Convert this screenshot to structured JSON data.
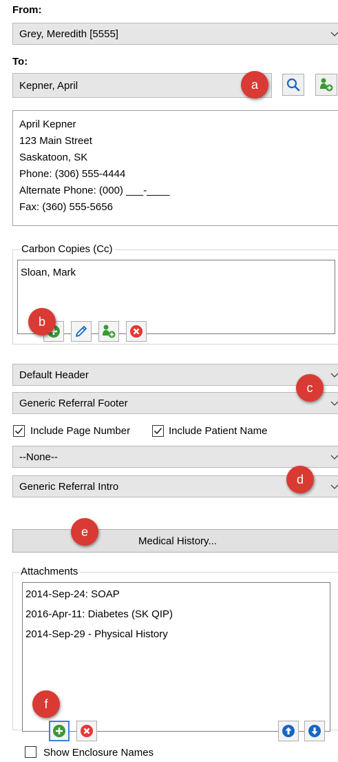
{
  "from": {
    "label": "From:",
    "value": "Grey, Meredith [5555]"
  },
  "to": {
    "label": "To:",
    "value": "Kepner, April"
  },
  "address": {
    "lines": [
      "April Kepner",
      "123 Main Street",
      "Saskatoon, SK",
      "Phone: (306) 555-4444",
      "Alternate Phone: (000) ___-____",
      "Fax: (360) 555-5656"
    ]
  },
  "cc": {
    "title": "Carbon Copies (Cc)",
    "items": [
      "Sloan, Mark"
    ]
  },
  "header_select": "Default Header",
  "footer_select": "Generic Referral Footer",
  "checkboxes": {
    "page_number": {
      "label": "Include Page Number",
      "checked": true
    },
    "patient_name": {
      "label": "Include Patient Name",
      "checked": true
    }
  },
  "none_select": "--None--",
  "intro_select": "Generic Referral Intro",
  "medical_history_button": "Medical History...",
  "attachments": {
    "title": "Attachments",
    "items": [
      "2014-Sep-24: SOAP",
      "2016-Apr-11: Diabetes (SK QIP)",
      "2014-Sep-29 - Physical History"
    ]
  },
  "show_enclosure": {
    "label": "Show Enclosure Names",
    "checked": false
  },
  "callouts": {
    "a": "a",
    "b": "b",
    "c": "c",
    "d": "d",
    "e": "e",
    "f": "f"
  },
  "colors": {
    "callout": "#d93a33",
    "green": "#3a9a35",
    "red": "#e53935",
    "blue": "#1766c4"
  }
}
